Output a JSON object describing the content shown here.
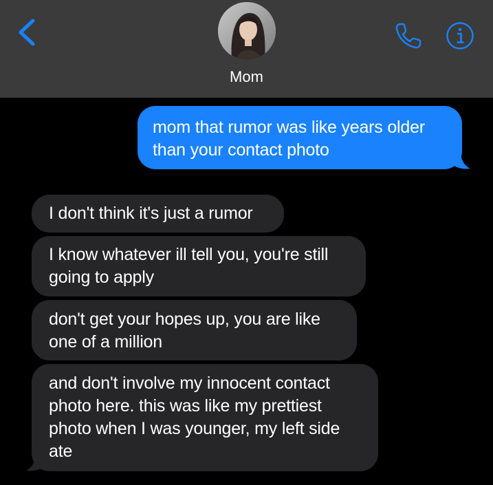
{
  "header": {
    "contact_name": "Mom",
    "back_icon": "chevron-left-icon",
    "call_icon": "phone-icon",
    "info_icon": "info-icon",
    "accent_color": "#1982fc",
    "background_color": "#3b3b3b"
  },
  "messages": [
    {
      "direction": "sent",
      "text": "mom that rumor was like years older\nthan your contact photo"
    },
    {
      "direction": "received",
      "text": "I don't think it's just a rumor"
    },
    {
      "direction": "received",
      "text": "I know whatever ill tell you, you're still\ngoing to apply"
    },
    {
      "direction": "received",
      "text": "don't get your hopes up, you are like\none of a million"
    },
    {
      "direction": "received",
      "text": "and don't involve my innocent contact\nphoto here. this was like my prettiest\nphoto when I was younger, my left side\nate"
    }
  ],
  "colors": {
    "sent_bubble": "#1982fc",
    "received_bubble": "#262629",
    "chat_background": "#000000"
  }
}
